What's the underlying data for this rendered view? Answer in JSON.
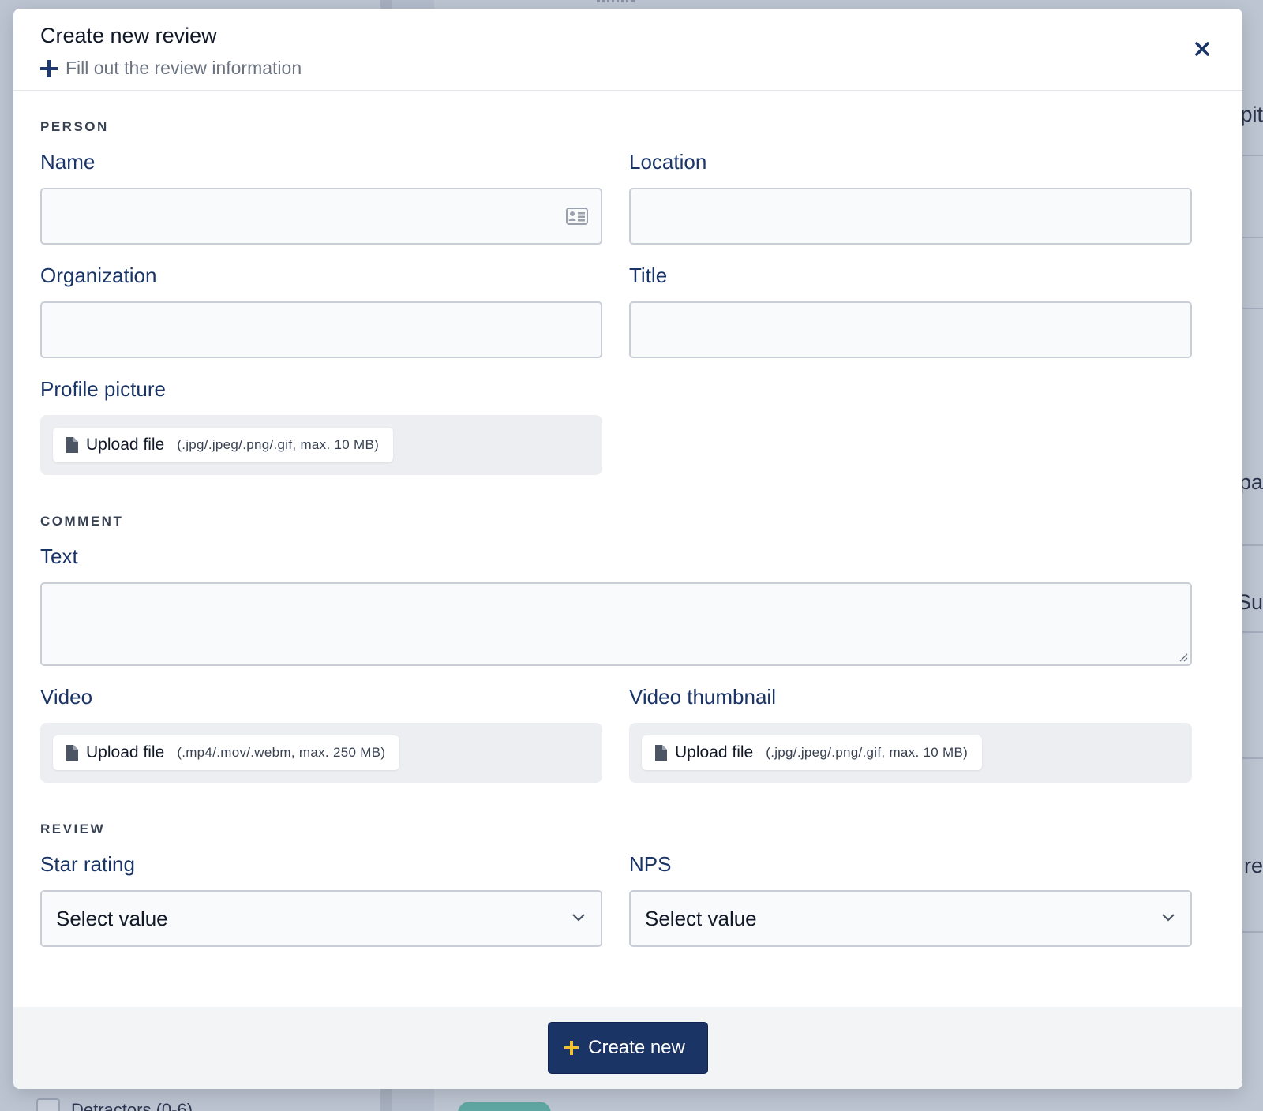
{
  "background": {
    "peek_texts": [
      "pit",
      "pa",
      "Su",
      "t re"
    ],
    "sidebar_filter": "Detractors (0-6)"
  },
  "modal": {
    "title": "Create new review",
    "subtitle": "Fill out the review information",
    "close_icon": "close-icon"
  },
  "sections": {
    "person": "PERSON",
    "comment": "COMMENT",
    "review": "REVIEW"
  },
  "fields": {
    "name": {
      "label": "Name",
      "value": ""
    },
    "location": {
      "label": "Location",
      "value": ""
    },
    "organization": {
      "label": "Organization",
      "value": ""
    },
    "title": {
      "label": "Title",
      "value": ""
    },
    "profile_picture": {
      "label": "Profile picture",
      "upload_label": "Upload file",
      "hint": "(.jpg/.jpeg/.png/.gif, max. 10 MB)"
    },
    "text": {
      "label": "Text",
      "value": ""
    },
    "video": {
      "label": "Video",
      "upload_label": "Upload file",
      "hint": "(.mp4/.mov/.webm, max. 250 MB)"
    },
    "video_thumbnail": {
      "label": "Video thumbnail",
      "upload_label": "Upload file",
      "hint": "(.jpg/.jpeg/.png/.gif, max. 10 MB)"
    },
    "star_rating": {
      "label": "Star rating",
      "selected": "Select value"
    },
    "nps": {
      "label": "NPS",
      "selected": "Select value"
    }
  },
  "footer": {
    "create_label": "Create new"
  },
  "colors": {
    "primary": "#1a3466",
    "accent_plus": "#f2c12e",
    "label": "#1a3466",
    "overlay": "#b6bfcd"
  }
}
